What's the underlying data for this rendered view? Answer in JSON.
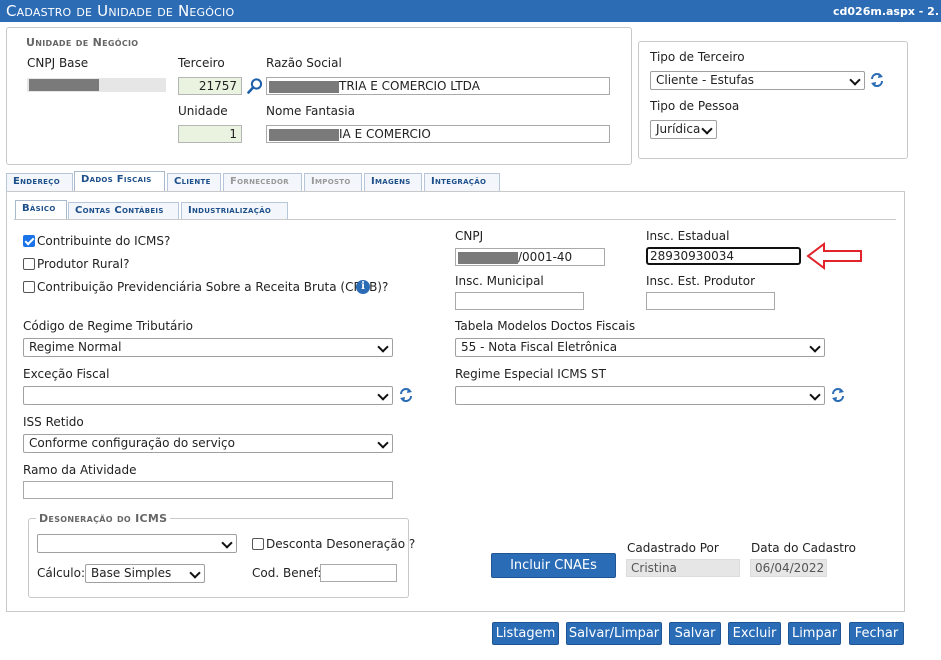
{
  "window": {
    "title": "Cadastro de Unidade de Negócio",
    "page_name": "cd026m.aspx - 2."
  },
  "unidade": {
    "legend": "Unidade de Negócio",
    "cnpj_base_label": "CNPJ Base",
    "terceiro_label": "Terceiro",
    "terceiro_value": "21757",
    "razao_label": "Razão Social",
    "razao_value": "TRIA E COMERCIO LTDA",
    "unidade_label": "Unidade",
    "unidade_value": "1",
    "fantasia_label": "Nome Fantasia",
    "fantasia_value": "IA E COMERCIO",
    "tipo_terceiro_label": "Tipo de Terceiro",
    "tipo_terceiro_value": "Cliente - Estufas",
    "tipo_pessoa_label": "Tipo de Pessoa",
    "tipo_pessoa_value": "Jurídica"
  },
  "tabs": [
    "Endereço",
    "Dados Fiscais",
    "Cliente",
    "Fornecedor",
    "Imposto",
    "Imagens",
    "Integração"
  ],
  "subtabs": [
    "Básico",
    "Contas Contábeis",
    "Industrialização"
  ],
  "basico": {
    "contribuinte_icms": "Contribuinte do ICMS?",
    "produtor_rural": "Produtor Rural?",
    "cprb": "Contribuição Previdenciária Sobre a Receita Bruta (CPRB)?",
    "cnpj_label": "CNPJ",
    "cnpj_value": "/0001-40",
    "insc_estadual_label": "Insc. Estadual",
    "insc_estadual_value": "28930930034",
    "insc_municipal_label": "Insc. Municipal",
    "insc_municipal_value": "",
    "insc_produtor_label": "Insc. Est. Produtor",
    "insc_produtor_value": "",
    "regime_label": "Código de Regime Tributário",
    "regime_value": "Regime Normal",
    "tabela_label": "Tabela Modelos Doctos Fiscais",
    "tabela_value": "55 - Nota Fiscal Eletrônica",
    "excecao_label": "Exceção Fiscal",
    "excecao_value": "",
    "regime_st_label": "Regime Especial ICMS ST",
    "regime_st_value": "",
    "iss_label": "ISS Retido",
    "iss_value": "Conforme configuração do serviço",
    "ramo_label": "Ramo da Atividade",
    "ramo_value": ""
  },
  "desoneracao": {
    "legend": "Desoneração do ICMS",
    "select_value": "",
    "desconta_label": "Desconta Desoneração ?",
    "calculo_label": "Cálculo:",
    "calculo_value": "Base Simples",
    "cod_benef_label": "Cod. Benef:",
    "cod_benef_value": ""
  },
  "incluir_cnaes": "Incluir CNAEs",
  "cadastrado_por_label": "Cadastrado Por",
  "cadastrado_por_value": "Cristina",
  "data_cadastro_label": "Data do Cadastro",
  "data_cadastro_value": "06/04/2022",
  "footer_buttons": [
    "Listagem",
    "Salvar/Limpar",
    "Salvar",
    "Excluir",
    "Limpar",
    "Fechar"
  ],
  "colors": {
    "accent": "#2b6cb5",
    "arrow": "#e0242a"
  }
}
